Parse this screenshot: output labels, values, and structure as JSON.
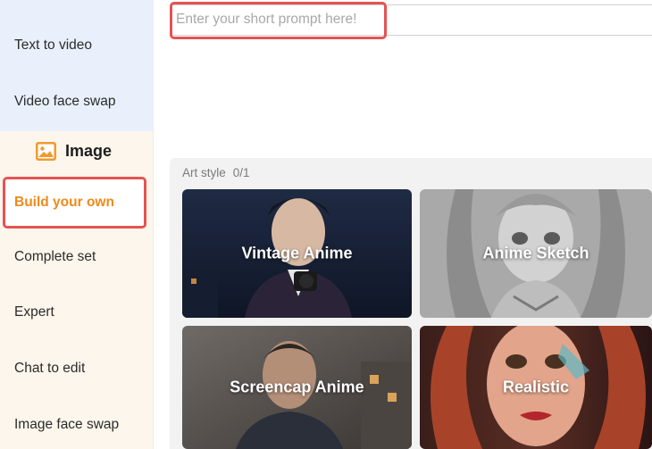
{
  "sidebar": {
    "video_items": [
      "Text to video",
      "Video face swap"
    ],
    "section_label": "Image",
    "active_item": "Build your own",
    "image_items": [
      "Complete set",
      "Expert",
      "Chat to edit",
      "Image face swap"
    ]
  },
  "prompt": {
    "placeholder": "Enter your short prompt here!",
    "value": ""
  },
  "art_style": {
    "label": "Art style",
    "count": "0/1",
    "cards": [
      {
        "label": "Vintage Anime"
      },
      {
        "label": "Anime Sketch"
      },
      {
        "label": "Screencap Anime"
      },
      {
        "label": "Realistic"
      }
    ]
  },
  "colors": {
    "active_orange": "#ee8a1a",
    "highlight_red": "#e55353",
    "sidebar_blue": "#e9f0fb",
    "sidebar_cream": "#fdf6ec"
  }
}
